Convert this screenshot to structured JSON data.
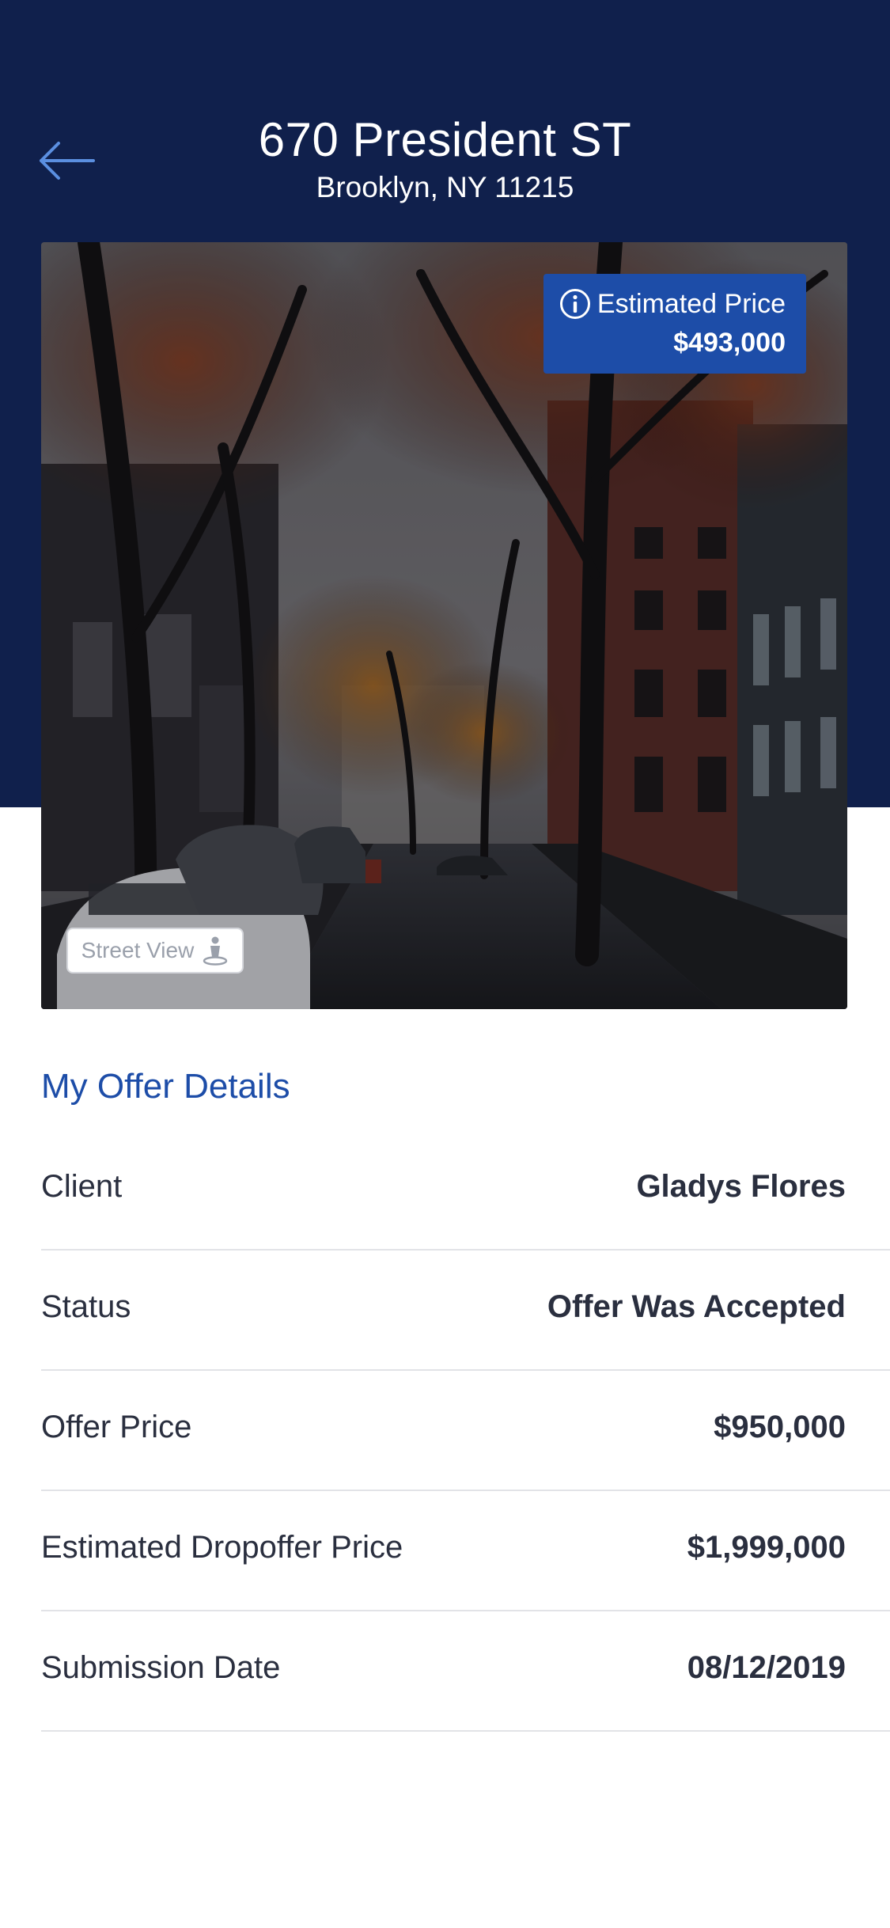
{
  "header": {
    "title": "670 President ST",
    "subtitle": "Brooklyn, NY 11215",
    "back_icon": "arrow-left-icon"
  },
  "photo": {
    "estimated_price_label": "Estimated Price",
    "estimated_price_value": "$493,000",
    "info_icon": "info-icon",
    "street_view_label": "Street View",
    "street_view_icon": "person-pin-icon"
  },
  "offer_details": {
    "title": "My Offer Details",
    "rows": [
      {
        "label": "Client",
        "value": "Gladys Flores"
      },
      {
        "label": "Status",
        "value": "Offer Was Accepted"
      },
      {
        "label": "Offer Price",
        "value": "$950,000"
      },
      {
        "label": "Estimated Dropoffer Price",
        "value": "$1,999,000"
      },
      {
        "label": "Submission Date",
        "value": "08/12/2019"
      }
    ]
  },
  "colors": {
    "header_bg": "#10204c",
    "accent": "#1d4da8",
    "text": "#2a2f3f",
    "divider": "#e2e3e7"
  }
}
